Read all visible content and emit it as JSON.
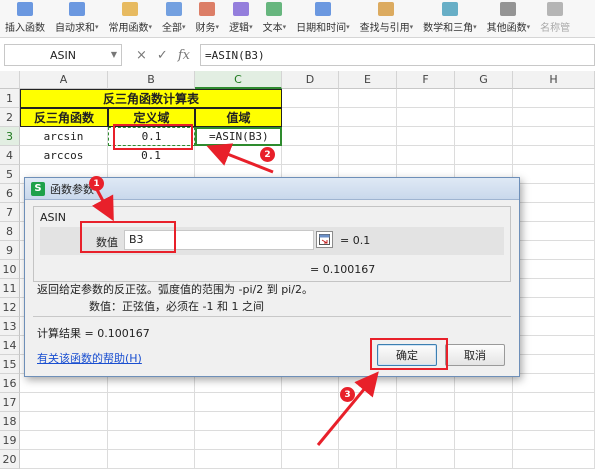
{
  "ribbon": {
    "items": [
      {
        "label": "插入函数",
        "caret": false
      },
      {
        "label": "自动求和",
        "caret": true
      },
      {
        "label": "常用函数",
        "caret": true
      },
      {
        "label": "全部",
        "caret": true
      },
      {
        "label": "财务",
        "caret": true
      },
      {
        "label": "逻辑",
        "caret": true
      },
      {
        "label": "文本",
        "caret": true
      },
      {
        "label": "日期和时间",
        "caret": true
      },
      {
        "label": "查找与引用",
        "caret": true
      },
      {
        "label": "数学和三角",
        "caret": true
      },
      {
        "label": "其他函数",
        "caret": true
      },
      {
        "label": "名称管",
        "caret": false
      }
    ]
  },
  "formula_bar": {
    "name_box": "ASIN",
    "cancel": "×",
    "enter": "✓",
    "fx": "fx",
    "formula": "=ASIN(B3)"
  },
  "grid": {
    "columns": [
      "A",
      "B",
      "C",
      "D",
      "E",
      "F",
      "G",
      "H"
    ],
    "rows": [
      "1",
      "2",
      "3",
      "4",
      "5",
      "6",
      "7",
      "8",
      "9",
      "10",
      "11",
      "12",
      "13",
      "14",
      "15",
      "16",
      "17",
      "18",
      "19",
      "20"
    ],
    "cells": {
      "title": "反三角函数计算表",
      "h_func": "反三角函数",
      "h_domain": "定义域",
      "h_range": "值域",
      "a3": "arcsin",
      "b3": "0.1",
      "c3": "=ASIN(B3)",
      "a4": "arccos",
      "b4": "0.1"
    }
  },
  "dialog": {
    "title": "函数参数",
    "function_name": "ASIN",
    "arg_label": "数值",
    "arg_value": "B3",
    "arg_result": "= 0.1",
    "fn_result": "= 0.100167",
    "desc": "返回给定参数的反正弦。弧度值的范围为 -pi/2 到 pi/2。",
    "param_desc": "数值：正弦值，必须在 -1 和 1 之间",
    "calc_result": "计算结果 = 0.100167",
    "help_link": "有关该函数的帮助(H)",
    "ok": "确定",
    "cancel": "取消"
  },
  "annotations": {
    "badge1": "1",
    "badge2": "2",
    "badge3": "3",
    "color": "#e8202a"
  }
}
